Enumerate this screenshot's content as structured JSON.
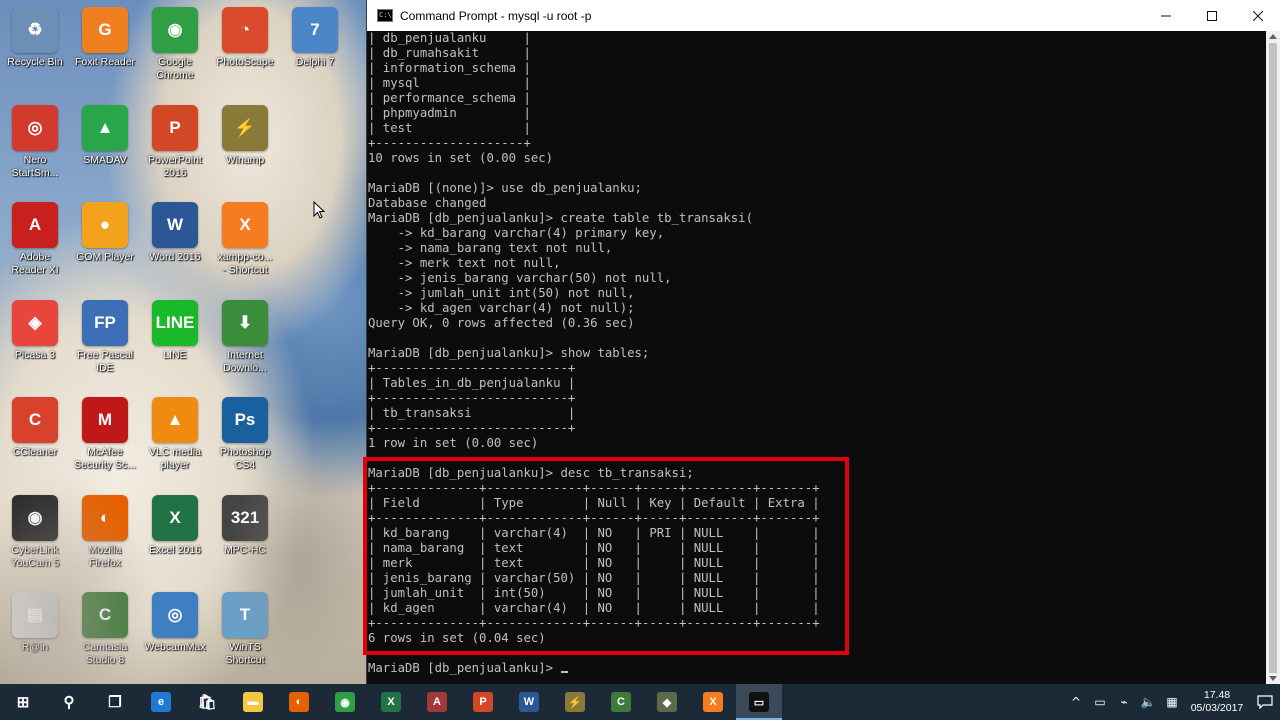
{
  "desktop": {
    "icons": [
      {
        "label": "Recycle Bin",
        "glyph": "♻",
        "color": "#6c8fb5",
        "col": 0,
        "row": 0
      },
      {
        "label": "Foxit Reader",
        "glyph": "G",
        "color": "#f07f22",
        "col": 1,
        "row": 0
      },
      {
        "label": "Google\nChrome",
        "glyph": "◉",
        "color": "#2f9e44",
        "col": 2,
        "row": 0
      },
      {
        "label": "PhotoScape",
        "glyph": "◔",
        "color": "#d94b2b",
        "col": 3,
        "row": 0
      },
      {
        "label": "Delphi 7",
        "glyph": "7",
        "color": "#4a86c8",
        "col": 4,
        "row": 0
      },
      {
        "label": "Nero\nStartSm...",
        "glyph": "◎",
        "color": "#d23a2e",
        "col": 0,
        "row": 1
      },
      {
        "label": "SMADAV",
        "glyph": "▲",
        "color": "#2aa64a",
        "col": 1,
        "row": 1
      },
      {
        "label": "PowerPoint\n2016",
        "glyph": "P",
        "color": "#d24726",
        "col": 2,
        "row": 1
      },
      {
        "label": "Winamp",
        "glyph": "⚡",
        "color": "#8a7a3a",
        "col": 3,
        "row": 1
      },
      {
        "label": "Adobe\nReader XI",
        "glyph": "A",
        "color": "#c8201c",
        "col": 0,
        "row": 2
      },
      {
        "label": "GOM Player",
        "glyph": "●",
        "color": "#f4a11d",
        "col": 1,
        "row": 2
      },
      {
        "label": "Word 2016",
        "glyph": "W",
        "color": "#2b5797",
        "col": 2,
        "row": 2
      },
      {
        "label": "xampp-co...\n- Shortcut",
        "glyph": "X",
        "color": "#f57c20",
        "col": 3,
        "row": 2
      },
      {
        "label": "Picasa 3",
        "glyph": "◈",
        "color": "#e8453c",
        "col": 0,
        "row": 3
      },
      {
        "label": "Free Pascal\nIDE",
        "glyph": "FP",
        "color": "#3c6fb6",
        "col": 1,
        "row": 3
      },
      {
        "label": "LINE",
        "glyph": "LINE",
        "color": "#19b929",
        "col": 2,
        "row": 3
      },
      {
        "label": "Internet\nDownlo...",
        "glyph": "⬇",
        "color": "#3b8d3b",
        "col": 3,
        "row": 3
      },
      {
        "label": "CCleaner",
        "glyph": "C",
        "color": "#d8422d",
        "col": 0,
        "row": 4
      },
      {
        "label": "McAfee\nSecurity Sc...",
        "glyph": "M",
        "color": "#c01818",
        "col": 1,
        "row": 4
      },
      {
        "label": "VLC media\nplayer",
        "glyph": "▲",
        "color": "#f08a11",
        "col": 2,
        "row": 4
      },
      {
        "label": "Photoshop\nCS4",
        "glyph": "Ps",
        "color": "#1a5f9e",
        "col": 3,
        "row": 4
      },
      {
        "label": "CyberLink\nYouCam 5",
        "glyph": "◉",
        "color": "#2b2b2b",
        "col": 0,
        "row": 5
      },
      {
        "label": "Mozilla\nFirefox",
        "glyph": "◐",
        "color": "#e66000",
        "col": 1,
        "row": 5
      },
      {
        "label": "Excel 2016",
        "glyph": "X",
        "color": "#217346",
        "col": 2,
        "row": 5
      },
      {
        "label": "MPC-HC",
        "glyph": "321",
        "color": "#444444",
        "col": 3,
        "row": 5
      },
      {
        "label": "R@in",
        "glyph": "▤",
        "color": "#d7d7d7",
        "col": 0,
        "row": 6
      },
      {
        "label": "Camtasia\nStudio 8",
        "glyph": "C",
        "color": "#3e7b3a",
        "col": 1,
        "row": 6
      },
      {
        "label": "WebcamMax",
        "glyph": "◎",
        "color": "#3d7fc1",
        "col": 2,
        "row": 6
      },
      {
        "label": "WinTS\nShortcut",
        "glyph": "T",
        "color": "#6a9fc8",
        "col": 3,
        "row": 6
      }
    ]
  },
  "window": {
    "title": "Command Prompt - mysql  -u root -p",
    "icon": "cmd-icon",
    "minimize": "—",
    "maximize": "☐",
    "close": "✕"
  },
  "terminal": {
    "lines": [
      "| db_penjualanku     |",
      "| db_rumahsakit      |",
      "| information_schema |",
      "| mysql              |",
      "| performance_schema |",
      "| phpmyadmin         |",
      "| test               |",
      "+--------------------+",
      "10 rows in set (0.00 sec)",
      "",
      "MariaDB [(none)]> use db_penjualanku;",
      "Database changed",
      "MariaDB [db_penjualanku]> create table tb_transaksi(",
      "    -> kd_barang varchar(4) primary key,",
      "    -> nama_barang text not null,",
      "    -> merk text not null,",
      "    -> jenis_barang varchar(50) not null,",
      "    -> jumlah_unit int(50) not null,",
      "    -> kd_agen varchar(4) not null);",
      "Query OK, 0 rows affected (0.36 sec)",
      "",
      "MariaDB [db_penjualanku]> show tables;",
      "+--------------------------+",
      "| Tables_in_db_penjualanku |",
      "+--------------------------+",
      "| tb_transaksi             |",
      "+--------------------------+",
      "1 row in set (0.00 sec)",
      "",
      "MariaDB [db_penjualanku]> desc tb_transaksi;",
      "+--------------+-------------+------+-----+---------+-------+",
      "| Field        | Type        | Null | Key | Default | Extra |",
      "+--------------+-------------+------+-----+---------+-------+",
      "| kd_barang    | varchar(4)  | NO   | PRI | NULL    |       |",
      "| nama_barang  | text        | NO   |     | NULL    |       |",
      "| merk         | text        | NO   |     | NULL    |       |",
      "| jenis_barang | varchar(50) | NO   |     | NULL    |       |",
      "| jumlah_unit  | int(50)     | NO   |     | NULL    |       |",
      "| kd_agen      | varchar(4)  | NO   |     | NULL    |       |",
      "+--------------+-------------+------+-----+---------+-------+",
      "6 rows in set (0.04 sec)",
      ""
    ],
    "prompt": "MariaDB [db_penjualanku]> "
  },
  "taskbar": {
    "apps": [
      {
        "name": "start-button",
        "glyph": "⊞",
        "color": "transparent"
      },
      {
        "name": "search-button",
        "glyph": "⚲",
        "color": "transparent"
      },
      {
        "name": "task-view-button",
        "glyph": "❐",
        "color": "transparent"
      },
      {
        "name": "edge-app",
        "glyph": "e",
        "color": "#1f78d1"
      },
      {
        "name": "store-app",
        "glyph": "🛍",
        "color": "transparent"
      },
      {
        "name": "file-explorer-app",
        "glyph": "▬",
        "color": "#f2c744"
      },
      {
        "name": "firefox-app",
        "glyph": "◐",
        "color": "#e66000"
      },
      {
        "name": "chrome-app",
        "glyph": "◉",
        "color": "#2f9e44"
      },
      {
        "name": "excel-app",
        "glyph": "X",
        "color": "#217346"
      },
      {
        "name": "access-app",
        "glyph": "A",
        "color": "#a4373a"
      },
      {
        "name": "powerpoint-app",
        "glyph": "P",
        "color": "#d24726"
      },
      {
        "name": "word-app",
        "glyph": "W",
        "color": "#2b5797"
      },
      {
        "name": "winamp-app",
        "glyph": "⚡",
        "color": "#8a7a3a"
      },
      {
        "name": "camtasia-app",
        "glyph": "C",
        "color": "#3e7b3a"
      },
      {
        "name": "camtasia-recorder-app",
        "glyph": "◆",
        "color": "#5a6b4a"
      },
      {
        "name": "xampp-app",
        "glyph": "X",
        "color": "#f57c20"
      },
      {
        "name": "cmd-app",
        "glyph": "▭",
        "color": "#111111",
        "active": true
      }
    ],
    "tray": {
      "chevron": "^",
      "battery": "▭",
      "network": "⌁",
      "volume": "🔈",
      "keyboard": "▦",
      "time": "17.48",
      "date": "05/03/2017"
    }
  }
}
